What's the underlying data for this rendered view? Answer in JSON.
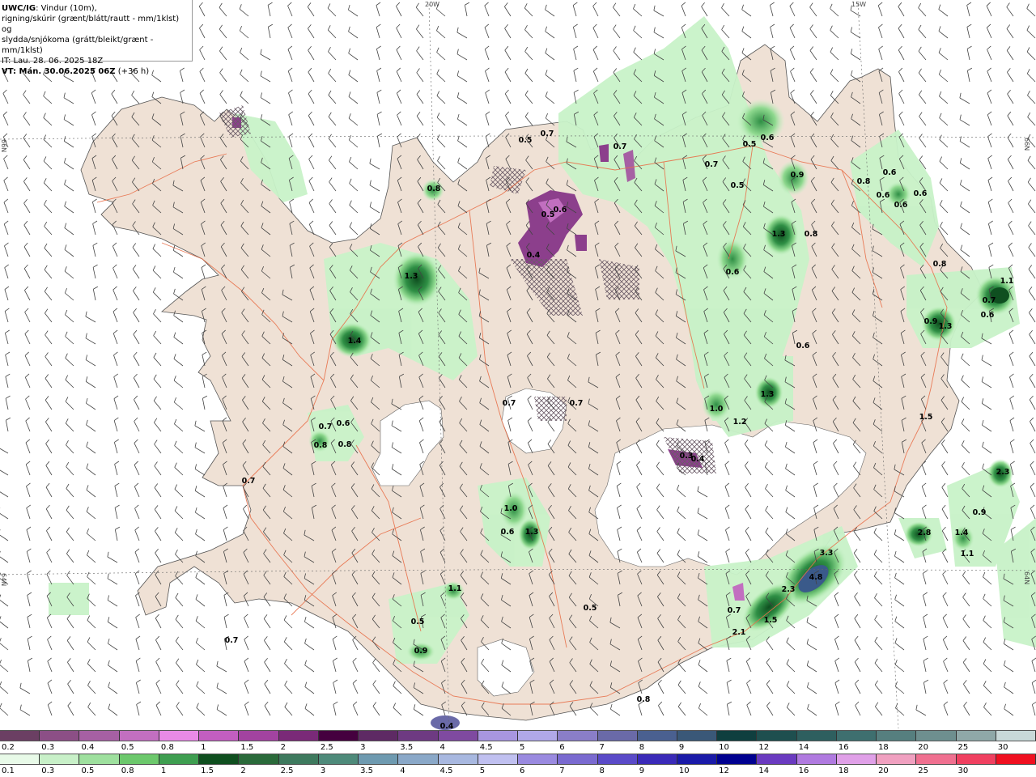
{
  "header": {
    "model": "UWC/IG",
    "line1_rest": ": Vindur (10m),",
    "line2": "rigning/skúrir (grænt/blátt/rautt - mm/1klst) og",
    "line3": "slydda/snjókoma (grátt/bleikt/grænt - mm/1klst)",
    "it": "IT: Lau. 28. 06. 2025 18Z",
    "vt_label": "VT: Mán. 30.06.2025 06Z",
    "vt_extra": " (+36 h)"
  },
  "grid_labels": {
    "lon_20": "20W",
    "lon_15": "15W",
    "lat_66_left": "66N",
    "lat_66_right": "66N",
    "lat_64_left": "64N",
    "lat_64_right": "64N"
  },
  "colors": {
    "land": "#efe1d5",
    "glacier": "#ffffff",
    "sea": "#ffffff",
    "roads": "#e8704a",
    "rain_light": "#c8f2c8",
    "rain_mid": "#8fd98f",
    "rain_dark": "#2f8f45",
    "rain_darkest": "#0f4f20",
    "snow_purple": "#8c3f8c"
  },
  "precip_values": [
    {
      "text": "0.8"
    },
    {
      "text": "0.5"
    },
    {
      "text": "0.7"
    },
    {
      "text": "0.7"
    },
    {
      "text": "0.5"
    },
    {
      "text": "0.6"
    },
    {
      "text": "0.7"
    },
    {
      "text": "0.5"
    },
    {
      "text": "0.9"
    },
    {
      "text": "0.8"
    },
    {
      "text": "0.6"
    },
    {
      "text": "0.6"
    },
    {
      "text": "0.6"
    },
    {
      "text": "0.6"
    },
    {
      "text": "1.3"
    },
    {
      "text": "0.8"
    },
    {
      "text": "0.8"
    },
    {
      "text": "0.6"
    },
    {
      "text": "1.1"
    },
    {
      "text": "0.7"
    },
    {
      "text": "0.9"
    },
    {
      "text": "1.3"
    },
    {
      "text": "0.6"
    },
    {
      "text": "0.6"
    },
    {
      "text": "1.3"
    },
    {
      "text": "1.4"
    },
    {
      "text": "0.7"
    },
    {
      "text": "0.6"
    },
    {
      "text": "0.8"
    },
    {
      "text": "0.8"
    },
    {
      "text": "0.7"
    },
    {
      "text": "0.7"
    },
    {
      "text": "0.7"
    },
    {
      "text": "1.0"
    },
    {
      "text": "1.2"
    },
    {
      "text": "1.3"
    },
    {
      "text": "1.5"
    },
    {
      "text": "1.0"
    },
    {
      "text": "0.6"
    },
    {
      "text": "1.3"
    },
    {
      "text": "2.3"
    },
    {
      "text": "0.9"
    },
    {
      "text": "2.8"
    },
    {
      "text": "1.4"
    },
    {
      "text": "1.1"
    },
    {
      "text": "1.1"
    },
    {
      "text": "0.5"
    },
    {
      "text": "0.5"
    },
    {
      "text": "0.9"
    },
    {
      "text": "0.7"
    },
    {
      "text": "3.3"
    },
    {
      "text": "4.8"
    },
    {
      "text": "2.3"
    },
    {
      "text": "0.7"
    },
    {
      "text": "2.1"
    },
    {
      "text": "1.5"
    },
    {
      "text": "0.8"
    },
    {
      "text": "0.4"
    },
    {
      "text": "0.5"
    },
    {
      "text": "0.6"
    },
    {
      "text": "0.4"
    },
    {
      "text": "0.3"
    },
    {
      "text": "0.4"
    }
  ],
  "colorbar_snow": {
    "labels": [
      "0.2",
      "0.3",
      "0.4",
      "0.5",
      "0.8",
      "1",
      "1.5",
      "2",
      "2.5",
      "3",
      "3.5",
      "4",
      "4.5",
      "5",
      "6",
      "7",
      "8",
      "9",
      "10",
      "12",
      "14",
      "16",
      "18",
      "20",
      "25",
      "30"
    ],
    "colors": [
      "#6b3f63",
      "#8c4f86",
      "#a660a3",
      "#c26fc0",
      "#e88ae6",
      "#c25ec0",
      "#a243a0",
      "#7a2a78",
      "#45003f",
      "#5e2a64",
      "#6e3a82",
      "#7f4aa0",
      "#a896e0",
      "#b0a8e8",
      "#8a7ec8",
      "#6a6aa8",
      "#4a6090",
      "#3a5878",
      "#0f3f3f",
      "#1e4f4f",
      "#2e5f5f",
      "#3e6f6f",
      "#567f7f",
      "#6e8f8f",
      "#8fa8a8",
      "#c8d8d8"
    ]
  },
  "colorbar_rain": {
    "labels": [
      "0.1",
      "0.3",
      "0.5",
      "0.8",
      "1",
      "1.5",
      "2",
      "2.5",
      "3",
      "3.5",
      "4",
      "4.5",
      "5",
      "6",
      "7",
      "8",
      "9",
      "10",
      "12",
      "14",
      "16",
      "18",
      "20",
      "25",
      "30"
    ],
    "colors": [
      "#e8fae8",
      "#c8f0c8",
      "#9ee09e",
      "#6cc86c",
      "#3e9e50",
      "#0f4f1f",
      "#2a6a3a",
      "#3e7a5e",
      "#4e8a7a",
      "#6e9ab0",
      "#8aa8c8",
      "#a8b8e0",
      "#c0c0f0",
      "#9a8ae0",
      "#7a6ad0",
      "#5a4ac8",
      "#3a2ab8",
      "#1a1aa8",
      "#000090",
      "#6a3ac0",
      "#b07ae0",
      "#e0a0e8",
      "#f0a0c0",
      "#f07090",
      "#f04060",
      "#f01020"
    ]
  }
}
